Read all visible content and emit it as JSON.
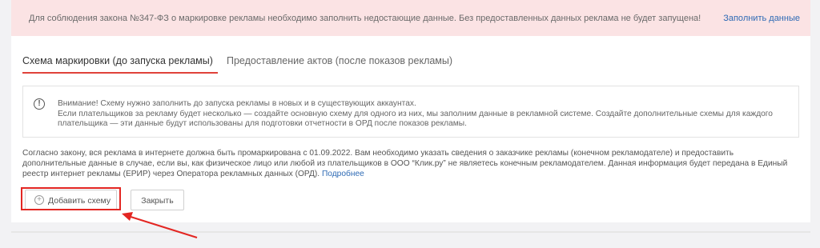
{
  "alert": {
    "text": "Для соблюдения закона №347-ФЗ о маркировке рекламы необходимо заполнить недостающие данные. Без предоставленных данных реклама не будет запущена!",
    "link": "Заполнить данные"
  },
  "tabs": [
    {
      "label": "Схема маркировки (до запуска рекламы)",
      "active": true
    },
    {
      "label": "Предоставление актов (после показов рекламы)",
      "active": false
    }
  ],
  "notice": {
    "icon": "exclamation-circle-icon",
    "line1": "Внимание! Схему нужно заполнить до запуска рекламы в новых и в существующих аккаунтах.",
    "line2": "Если плательщиков за рекламу будет несколько — создайте основную схему для одного из них, мы заполним данные в рекламной системе. Создайте дополнительные схемы для каждого плательщика — эти данные будут использованы для подготовки отчетности в ОРД после показов рекламы."
  },
  "description": {
    "text": "Согласно закону, вся реклама в интернете должна быть промаркирована с 01.09.2022. Вам необходимо указать сведения о заказчике рекламы (конечном рекламодателе) и предоставить дополнительные данные в случае, если вы, как физическое лицо или любой из плательщиков в ООО “Клик.ру” не являетесь конечным рекламодателем. Данная информация будет передана в Единый реестр интернет рекламы (ЕРИР) через Оператора рекламных данных (ОРД).",
    "link": "Подробнее"
  },
  "buttons": {
    "add_scheme": "Добавить схему",
    "close": "Закрыть"
  },
  "colors": {
    "alert_bg": "#fbe3e4",
    "accent_red": "#e32622",
    "link_blue": "#2f6bb5"
  }
}
